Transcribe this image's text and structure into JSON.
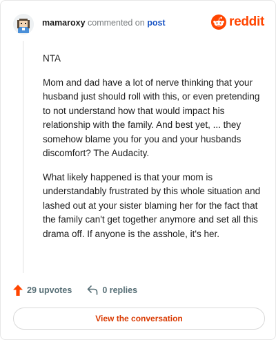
{
  "comment": {
    "username": "mamaroxy",
    "action_text": "commented on",
    "post_link_label": "post",
    "brand": "reddit",
    "paragraphs": [
      "NTA",
      "Mom and dad have a lot of nerve thinking that your husband just should roll with this, or even pretending to not understand how that would impact his relationship with the family. And best yet, ... they somehow blame you for you and your husbands discomfort? The Audacity.",
      "What likely happened is that your mom is understandably frustrated by this whole situation and lashed out at your sister blaming her for the fact that the family can't get together anymore and set all this drama off. If anyone is the asshole, it's her."
    ],
    "upvotes_label": "29 upvotes",
    "replies_label": "0 replies",
    "view_conversation_label": "View the conversation"
  },
  "colors": {
    "brand": "#ff4500",
    "link": "#1a55c4",
    "cta_text": "#d93900",
    "muted": "#787c7e"
  },
  "icons": [
    "avatar",
    "reddit-snoo-icon",
    "upvote-arrow-icon",
    "reply-icon"
  ]
}
